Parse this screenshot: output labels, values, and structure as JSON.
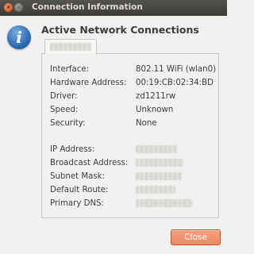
{
  "window": {
    "title": "Connection Information",
    "close_glyph": "×",
    "minimize_glyph": "–"
  },
  "header": {
    "icon": "info-icon",
    "icon_glyph": "i",
    "title": "Active Network Connections"
  },
  "tab": {
    "label": "(redacted)"
  },
  "details": [
    {
      "label": "Interface:",
      "value": "802.11 WiFi (wlan0)"
    },
    {
      "label": "Hardware Address:",
      "value": "00:19:CB:02:34:BD"
    },
    {
      "label": "Driver:",
      "value": "zd1211rw"
    },
    {
      "label": "Speed:",
      "value": "Unknown"
    },
    {
      "label": "Security:",
      "value": "None"
    }
  ],
  "ip_details": [
    {
      "label": "IP Address:",
      "value": "(redacted)"
    },
    {
      "label": "Broadcast Address:",
      "value": "(redacted)"
    },
    {
      "label": "Subnet Mask:",
      "value": "(redacted)"
    },
    {
      "label": "Default Route:",
      "value": "(redacted)"
    },
    {
      "label": "Primary DNS:",
      "value": "(redacted)"
    }
  ],
  "buttons": {
    "close_label": "Close"
  },
  "colors": {
    "accent": "#ee8a62",
    "titlebar": "#3c3b37",
    "info_icon": "#2d6bb5"
  }
}
